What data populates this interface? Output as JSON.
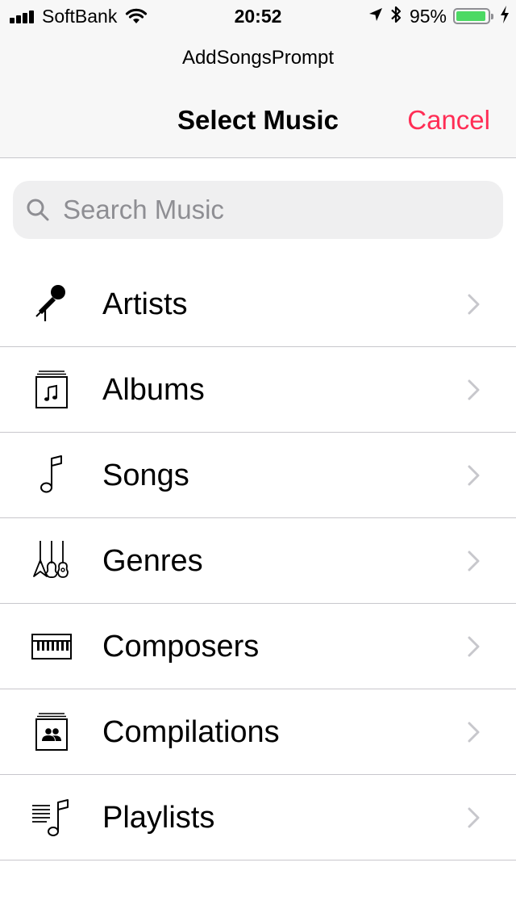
{
  "status_bar": {
    "carrier": "SoftBank",
    "time": "20:52",
    "battery_percent": "95%",
    "battery_level": 0.95,
    "battery_color": "#4cd964"
  },
  "prompt": "AddSongsPrompt",
  "nav": {
    "title": "Select Music",
    "cancel_label": "Cancel",
    "cancel_color": "#ff2d55"
  },
  "search": {
    "placeholder": "Search Music",
    "value": ""
  },
  "categories": [
    {
      "label": "Artists",
      "icon": "microphone-icon"
    },
    {
      "label": "Albums",
      "icon": "album-icon"
    },
    {
      "label": "Songs",
      "icon": "music-note-icon"
    },
    {
      "label": "Genres",
      "icon": "guitars-icon"
    },
    {
      "label": "Composers",
      "icon": "piano-icon"
    },
    {
      "label": "Compilations",
      "icon": "compilation-icon"
    },
    {
      "label": "Playlists",
      "icon": "playlist-icon"
    }
  ]
}
